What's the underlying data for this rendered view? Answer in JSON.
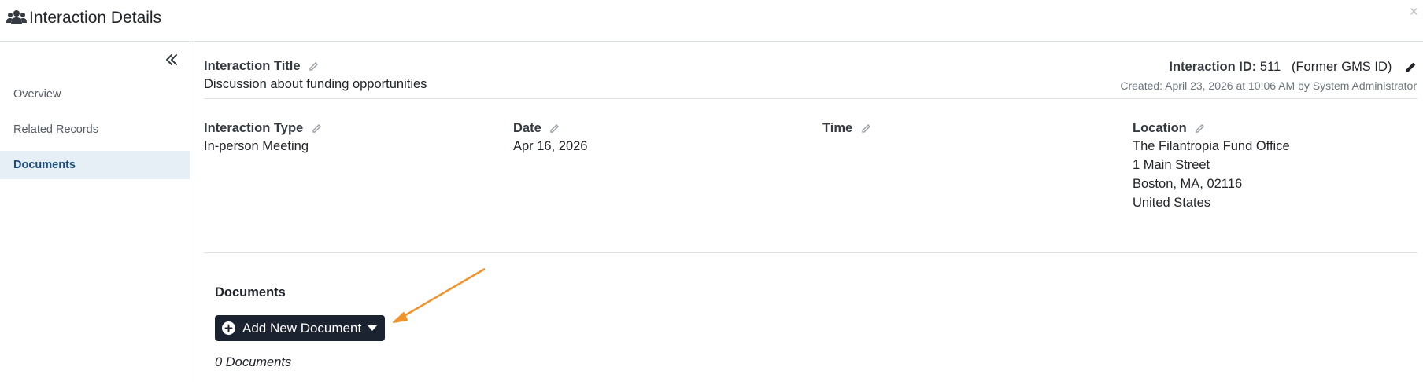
{
  "header": {
    "icon": "users-icon",
    "title": "Interaction Details",
    "close_label": "×"
  },
  "sidebar": {
    "collapse_icon": "chevron-double-left-icon",
    "items": [
      {
        "label": "Overview",
        "active": false
      },
      {
        "label": "Related Records",
        "active": false
      },
      {
        "label": "Documents",
        "active": true
      }
    ]
  },
  "main": {
    "title_label": "Interaction Title",
    "title_value": "Discussion about funding opportunities",
    "id_label": "Interaction ID:",
    "id_value": "511",
    "former_gms": "(Former GMS ID)",
    "created": "Created: April 23, 2026 at 10:06 AM by System Administrator",
    "fields": [
      {
        "label": "Interaction Type",
        "value": "In-person Meeting"
      },
      {
        "label": "Date",
        "value": "Apr 16, 2026"
      },
      {
        "label": "Time",
        "value": ""
      },
      {
        "label": "Location",
        "lines": [
          "The Filantropia Fund Office",
          "1 Main Street",
          "Boston, MA, 02116",
          "United States"
        ]
      }
    ],
    "documents": {
      "heading": "Documents",
      "add_button": "Add New Document",
      "count_text": "0 Documents"
    }
  },
  "colors": {
    "accent_button": "#1b2230",
    "active_nav_bg": "#e6eef6",
    "active_nav_text": "#1b4f7d",
    "annotation_arrow": "#f0932b"
  }
}
